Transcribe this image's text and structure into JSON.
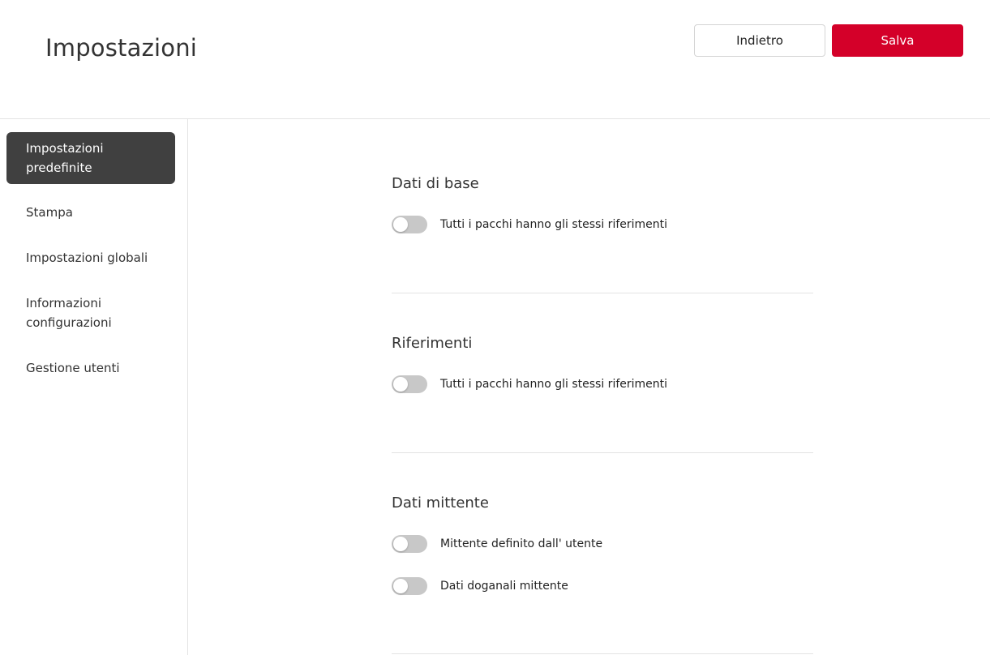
{
  "header": {
    "title": "Impostazioni",
    "back_label": "Indietro",
    "save_label": "Salva"
  },
  "sidebar": {
    "items": [
      {
        "label": "Impostazioni predefinite",
        "active": true
      },
      {
        "label": "Stampa",
        "active": false
      },
      {
        "label": "Impostazioni globali",
        "active": false
      },
      {
        "label": "Informazioni configurazioni",
        "active": false
      },
      {
        "label": "Gestione utenti",
        "active": false
      }
    ]
  },
  "sections": [
    {
      "title": "Dati di base",
      "toggles": [
        {
          "label": "Tutti i pacchi hanno gli stessi riferimenti",
          "on": false
        }
      ]
    },
    {
      "title": "Riferimenti",
      "toggles": [
        {
          "label": "Tutti i pacchi hanno gli stessi riferimenti",
          "on": false
        }
      ]
    },
    {
      "title": "Dati mittente",
      "toggles": [
        {
          "label": "Mittente definito dall' utente",
          "on": false
        },
        {
          "label": "Dati doganali mittente",
          "on": false
        }
      ]
    }
  ],
  "colors": {
    "accent": "#d40029",
    "nav_active_bg": "#404040",
    "toggle_off": "#c8c8c8"
  }
}
